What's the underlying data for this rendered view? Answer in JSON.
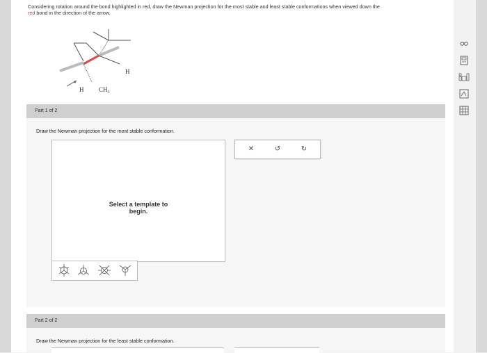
{
  "question": {
    "line1": "Considering rotation around the bond highlighted in red, draw the Newman projection for the most stable and least stable conformations when viewed down the",
    "line2_red": "red",
    "line2_rest": " bond in the direction of the arrow."
  },
  "molecule": {
    "label_h1": "H",
    "label_ch3": "CH",
    "label_ch3_sub": "3",
    "label_h2": "H",
    "colors": {
      "highlight": "#e04848",
      "bond": "#555555"
    }
  },
  "part1": {
    "label": "Part 1 of 2",
    "prompt": "Draw the Newman projection for the most stable conformation.",
    "canvas_message_line1": "Select a template to",
    "canvas_message_line2": "begin."
  },
  "part2": {
    "label": "Part 2 of 2",
    "prompt": "Draw the Newman projection for the least stable conformation."
  },
  "templates": [
    "newman-staggered-icon",
    "newman-eclipsed-icon",
    "newman-staggered-alt-icon",
    "newman-partial-icon"
  ],
  "tools": {
    "clear": "✕",
    "undo": "↺",
    "redo": "↻"
  },
  "sidebar": [
    "infinity-icon",
    "calculator-icon",
    "periodic-table-icon",
    "reference-icon",
    "grid-icon"
  ]
}
